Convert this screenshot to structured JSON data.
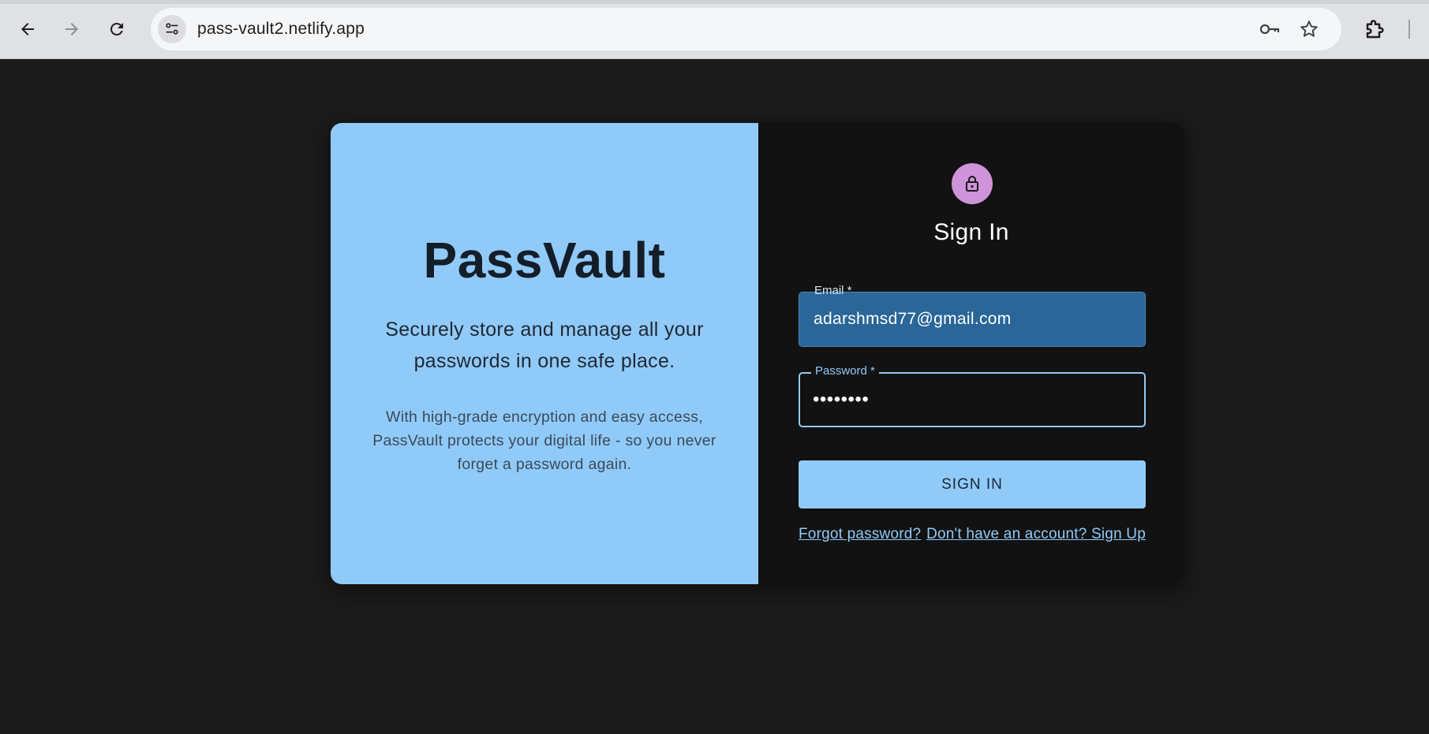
{
  "browser": {
    "url": "pass-vault2.netlify.app",
    "icons": {
      "back": "arrow-left-icon",
      "forward": "arrow-right-icon",
      "reload": "reload-icon",
      "site_info": "tune-icon",
      "password_manager": "key-icon",
      "bookmark": "star-icon",
      "extensions": "puzzle-icon"
    }
  },
  "left_panel": {
    "brand": "PassVault",
    "tagline": "Securely store and manage all your passwords in one safe place.",
    "description": "With high-grade encryption and easy access, PassVault protects your digital life - so you never forget a password again.",
    "background_color": "#90caf9"
  },
  "form": {
    "avatar_icon": "lock-icon",
    "avatar_color": "#ce93d8",
    "title": "Sign In",
    "email": {
      "label": "Email *",
      "value": "adarshmsd77@gmail.com"
    },
    "password": {
      "label": "Password *",
      "value": "••••••••"
    },
    "submit_label": "SIGN IN",
    "forgot_link": "Forgot password?",
    "signup_link": "Don't have an account? Sign Up",
    "accent_color": "#90caf9"
  }
}
